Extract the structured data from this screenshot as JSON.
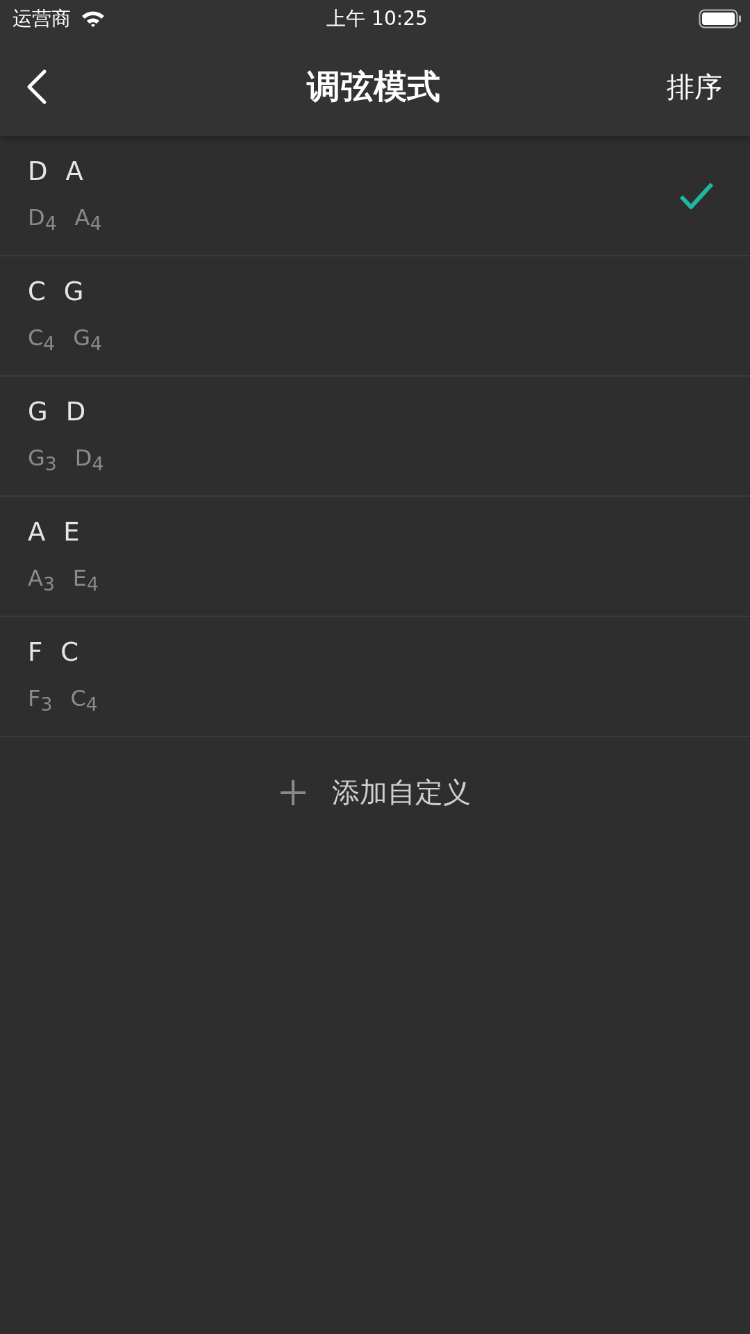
{
  "status_bar": {
    "carrier": "运营商",
    "time": "上午 10:25"
  },
  "nav": {
    "title": "调弦模式",
    "action": "排序"
  },
  "tunings": [
    {
      "selected": true,
      "notes": [
        {
          "name": "D",
          "pitch": "D$_{4}$"
        },
        {
          "name": "A",
          "pitch": "A$_{4}$"
        }
      ]
    },
    {
      "selected": false,
      "notes": [
        {
          "name": "C",
          "pitch": "C$_{4}$"
        },
        {
          "name": "G",
          "pitch": "G$_{4}$"
        }
      ]
    },
    {
      "selected": false,
      "notes": [
        {
          "name": "G",
          "pitch": "G$_{3}$"
        },
        {
          "name": "D",
          "pitch": "D$_{4}$"
        }
      ]
    },
    {
      "selected": false,
      "notes": [
        {
          "name": "A",
          "pitch": "A$_{3}$"
        },
        {
          "name": "E",
          "pitch": "E$_{4}$"
        }
      ]
    },
    {
      "selected": false,
      "notes": [
        {
          "name": "F",
          "pitch": "F$_{3}$"
        },
        {
          "name": "C",
          "pitch": "C$_{4}$"
        }
      ]
    }
  ],
  "add_button": {
    "label": "添加自定义"
  }
}
